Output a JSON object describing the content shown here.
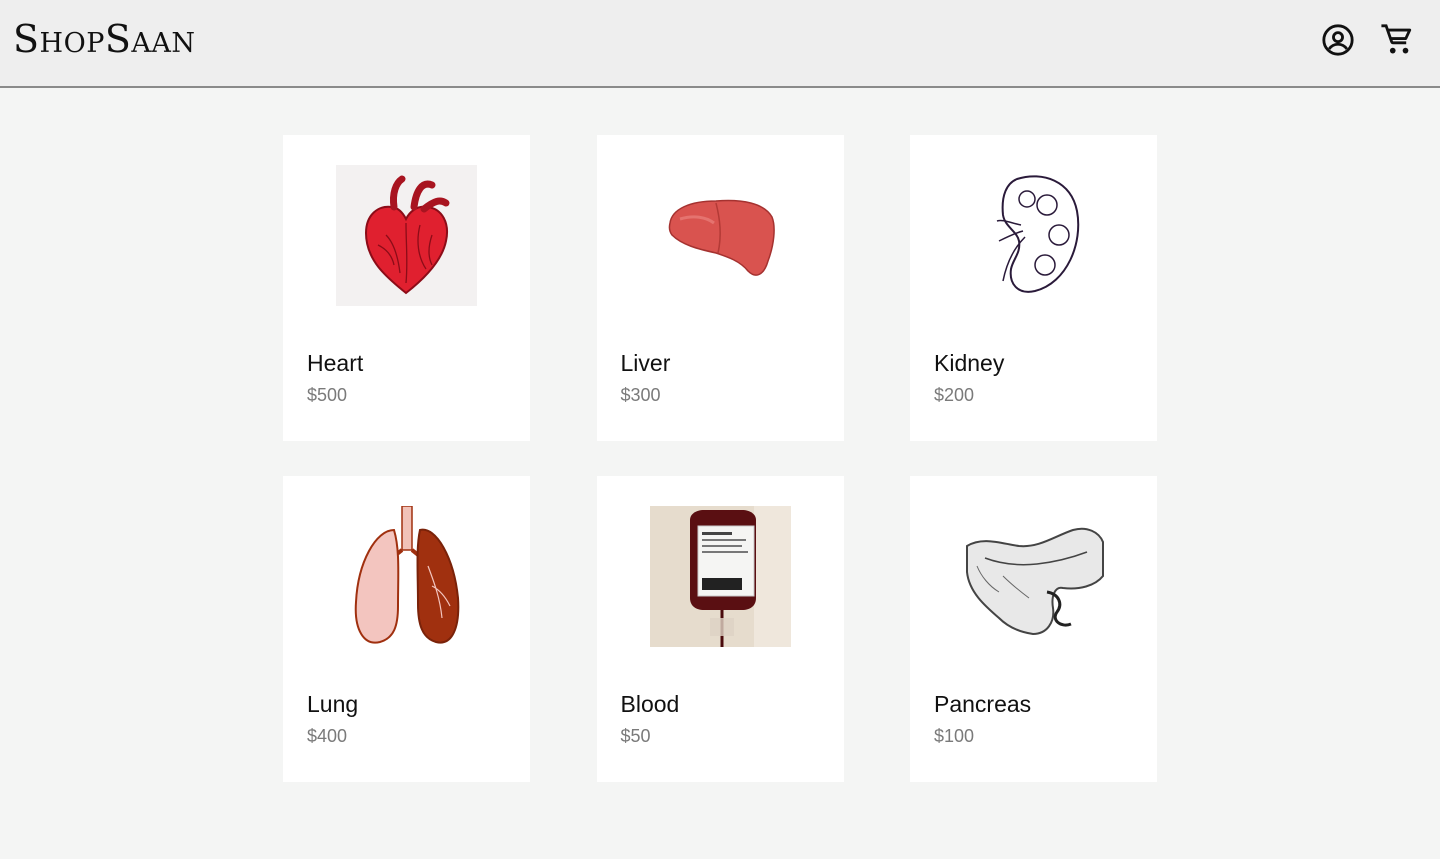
{
  "header": {
    "brand": "ShopSaan",
    "account_icon": "account-circle-icon",
    "cart_icon": "shopping-cart-icon"
  },
  "products": [
    {
      "name": "Heart",
      "price": "$500",
      "image": "heart-image",
      "accent": "#e0202f"
    },
    {
      "name": "Liver",
      "price": "$300",
      "image": "liver-image",
      "accent": "#d9534f"
    },
    {
      "name": "Kidney",
      "price": "$200",
      "image": "kidney-image",
      "accent": "#2a1a3a"
    },
    {
      "name": "Lung",
      "price": "$400",
      "image": "lung-image",
      "accent": "#a0300f"
    },
    {
      "name": "Blood",
      "price": "$50",
      "image": "blood-bag-image",
      "accent": "#5a0f12"
    },
    {
      "name": "Pancreas",
      "price": "$100",
      "image": "pancreas-image",
      "accent": "#444444"
    }
  ]
}
